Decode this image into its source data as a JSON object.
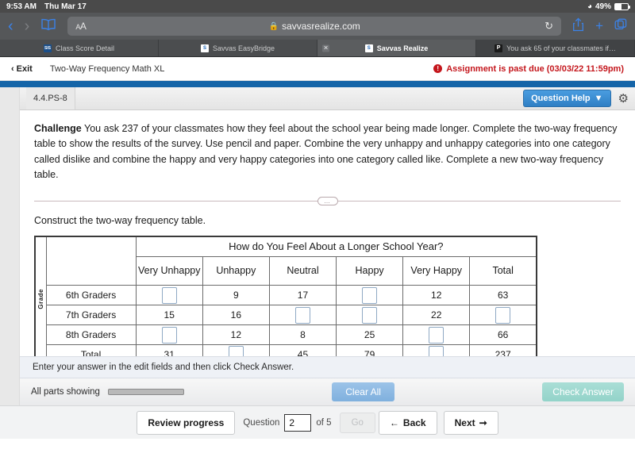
{
  "status_bar": {
    "time": "9:53 AM",
    "date": "Thu Mar 17",
    "battery_percent": "49%",
    "wifi_icon": "wifi-icon",
    "battery_icon": "battery-icon"
  },
  "browser": {
    "back_icon": "chevron-left-icon",
    "forward_icon": "chevron-right-icon",
    "bookmarks_icon": "book-icon",
    "text_size_label": "AA",
    "lock_icon": "lock-icon",
    "url": "savvasrealize.com",
    "reload_icon": "reload-icon",
    "share_icon": "share-icon",
    "new_tab_icon": "plus-icon",
    "tabs_overview_icon": "tabs-icon",
    "tabs": [
      {
        "title": "Class Score Detail",
        "favicon": "sis-favicon",
        "favicon_text": "SIS",
        "state": "inactive",
        "closable": false
      },
      {
        "title": "Savvas EasyBridge",
        "favicon": "savvas-favicon",
        "favicon_text": "S",
        "state": "inactive",
        "closable": false
      },
      {
        "title": "Savvas Realize",
        "favicon": "savvas-favicon",
        "favicon_text": "S",
        "state": "active",
        "closable": true,
        "close_label": "✕"
      },
      {
        "title": "You ask 65 of your classmates if…",
        "favicon": "pearson-favicon",
        "favicon_text": "P",
        "state": "dim",
        "closable": false
      }
    ]
  },
  "page_header": {
    "exit_label": "Exit",
    "exit_icon": "chevron-left-icon",
    "assignment_title": "Two-Way Frequency Math XL",
    "alert_icon": "alert-circle-icon",
    "alert_badge": "!",
    "past_due_text": "Assignment is past due (03/03/22 11:59pm)"
  },
  "question_bar": {
    "question_code": "4.4.PS-8",
    "question_help_label": "Question Help",
    "question_help_caret": "▼",
    "settings_icon": "gear-icon"
  },
  "question": {
    "challenge_label": "Challenge",
    "prompt": "You ask 237 of your classmates how they feel about the school year being made longer. Complete the two-way frequency table to show the results of the survey. Use pencil and paper. Combine the very unhappy and unhappy categories into one category called dislike and combine the happy and very happy categories into one category called like. Complete a new two-way frequency table.",
    "divider_pill": "…",
    "construct_text": "Construct the two-way frequency table."
  },
  "table": {
    "axis_label": "Grade",
    "super_header": "How do You Feel About a Longer School Year?",
    "column_headers": [
      "Very Unhappy",
      "Unhappy",
      "Neutral",
      "Happy",
      "Very Happy",
      "Total"
    ],
    "rows": [
      {
        "label": "6th Graders",
        "cells": [
          "",
          "9",
          "17",
          "",
          "12",
          "63"
        ]
      },
      {
        "label": "7th Graders",
        "cells": [
          "15",
          "16",
          "",
          "",
          "22",
          ""
        ]
      },
      {
        "label": "8th Graders",
        "cells": [
          "",
          "12",
          "8",
          "25",
          "",
          "66"
        ]
      },
      {
        "label": "Total",
        "cells": [
          "31",
          "",
          "45",
          "79",
          "",
          "237"
        ]
      }
    ]
  },
  "instruction": {
    "text": "Enter your answer in the edit fields and then click Check Answer."
  },
  "action_bar": {
    "parts_label": "All parts showing",
    "clear_all_label": "Clear All",
    "check_answer_label": "Check Answer"
  },
  "bottom_bar": {
    "review_progress_label": "Review progress",
    "question_label": "Question",
    "question_value": "2",
    "of_label": "of 5",
    "go_label": "Go",
    "back_label": "Back",
    "back_icon": "arrow-left-icon",
    "next_label": "Next",
    "next_icon": "arrow-right-icon"
  },
  "colors": {
    "accent_blue": "#1565a8",
    "alert_red": "#c4161c",
    "help_button_blue": "#3f8fd4",
    "clear_all_blue": "#8fbae3",
    "check_answer_teal": "#9dd8cf",
    "chrome_gray": "#555759"
  }
}
